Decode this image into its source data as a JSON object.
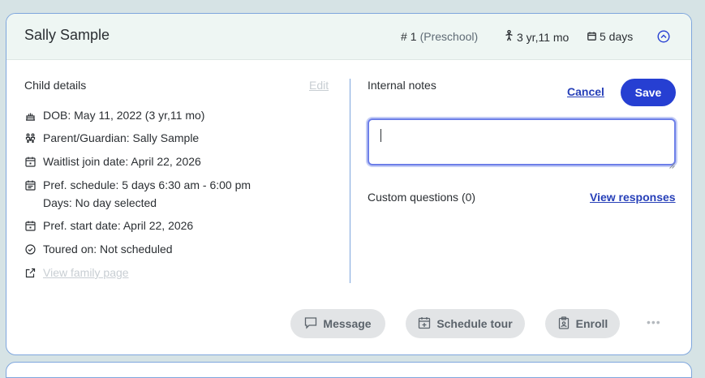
{
  "header": {
    "child_name": "Sally Sample",
    "rank_symbol": "#",
    "rank": "1",
    "program": "(Preschool)",
    "age": "3 yr,11 mo",
    "days": "5 days",
    "collapse_icon": "chevron-up-circle-icon"
  },
  "child_details": {
    "title": "Child details",
    "edit_label": "Edit",
    "rows": [
      {
        "icon": "cake-icon",
        "text": "DOB: May 11, 2022 (3 yr,11 mo)"
      },
      {
        "icon": "family-icon",
        "text": "Parent/Guardian: Sally Sample"
      },
      {
        "icon": "calendar-icon",
        "text": "Waitlist join date: April 22, 2026"
      },
      {
        "icon": "calendar-icon",
        "text": "Pref. schedule: 5 days 6:30 am - 6:00 pm",
        "text2": "Days: No day selected"
      },
      {
        "icon": "calendar-icon",
        "text": "Pref. start date: April 22, 2026"
      },
      {
        "icon": "check-circle-icon",
        "text": "Toured on: Not scheduled"
      },
      {
        "icon": "external-link-icon",
        "text": "View family page"
      }
    ]
  },
  "notes": {
    "title": "Internal notes",
    "cancel_label": "Cancel",
    "save_label": "Save",
    "value": "",
    "placeholder": ""
  },
  "custom_questions": {
    "label": "Custom questions (0)",
    "view_responses_label": "View responses"
  },
  "actions": {
    "message_label": "Message",
    "tour_label": "Schedule tour",
    "enroll_label": "Enroll",
    "more_label": "•••"
  },
  "colors": {
    "accent": "#263fd2",
    "header_bg": "#eef6f3",
    "card_border": "#7ea6dd",
    "page_bg": "#d6e3e5"
  }
}
